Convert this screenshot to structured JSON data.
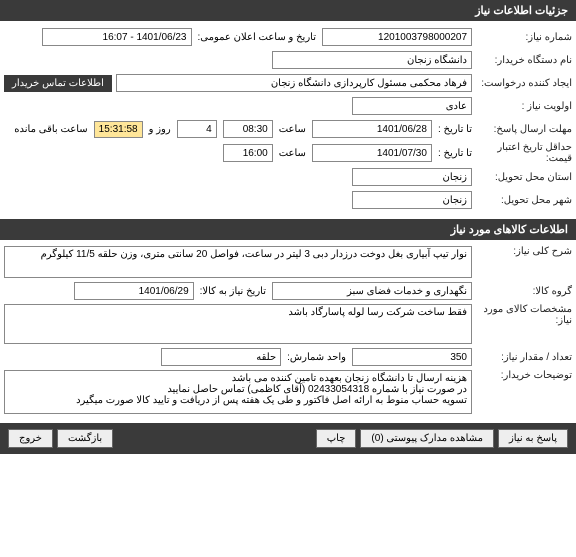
{
  "sections": {
    "need_info_title": "جزئیات اطلاعات نیاز",
    "goods_info_title": "اطلاعات کالاهای مورد نیاز"
  },
  "need": {
    "number_label": "شماره نیاز:",
    "number_value": "1201003798000207",
    "announce_label": "تاریخ و ساعت اعلان عمومی:",
    "announce_value": "1401/06/23 - 16:07",
    "buyer_label": "نام دستگاه خریدار:",
    "buyer_value": "دانشگاه زنجان",
    "creator_label": "ایجاد کننده درخواست:",
    "creator_value": "فرهاد محکمی مسئول کارپردازی دانشگاه زنجان",
    "contact_button": "اطلاعات تماس خریدار",
    "priority_label": "اولویت نیاز :",
    "priority_value": "عادی",
    "deadline_label": "مهلت ارسال پاسخ:",
    "to_date_label": "تا تاریخ :",
    "deadline_date": "1401/06/28",
    "time_label": "ساعت",
    "deadline_time": "08:30",
    "days_value": "4",
    "days_label": "روز و",
    "remaining_time": "15:31:58",
    "remaining_label": "ساعت باقی مانده",
    "credit_min_label": "حداقل تاریخ اعتبار قیمت:",
    "credit_date": "1401/07/30",
    "credit_time": "16:00",
    "delivery_province_label": "استان محل تحویل:",
    "delivery_province": "زنجان",
    "delivery_city_label": "شهر محل تحویل:",
    "delivery_city": "زنجان"
  },
  "goods": {
    "desc_label": "شرح کلی نیاز:",
    "desc_value": "نوار تیپ آبیاری بغل دوخت درزدار دبی 3 لیتر در ساعت، فواصل 20 سانتی متری، وزن حلقه 11/5 کیلوگرم",
    "group_label": "گروه کالا:",
    "group_value": "نگهداری و خدمات فضای سبز",
    "need_date_label": "تاریخ نیاز به کالا:",
    "need_date_value": "1401/06/29",
    "spec_label": "مشخصات کالای مورد نیاز:",
    "spec_value": "فقط ساخت شرکت رسا لوله پاسارگاد باشد",
    "qty_label": "تعداد / مقدار نیاز:",
    "qty_value": "350",
    "unit_label": "واحد شمارش:",
    "unit_value": "حلقه",
    "notes_label": "توضیحات خریدار:",
    "notes_value": "هزینه ارسال تا دانشگاه زنجان بعهده تامین کننده می باشد\nدر صورت نیاز با شماره 02433054318 (آقای کاظمی) تماس حاصل نمایید\nتسویه حساب منوط به ارائه اصل فاکتور و طی یک هفته پس از دریافت و تایید کالا صورت میگیرد"
  },
  "footer": {
    "respond": "پاسخ به نیاز",
    "attachments": "مشاهده مدارک پیوستی (0)",
    "print": "چاپ",
    "back": "بازگشت",
    "exit": "خروج"
  }
}
